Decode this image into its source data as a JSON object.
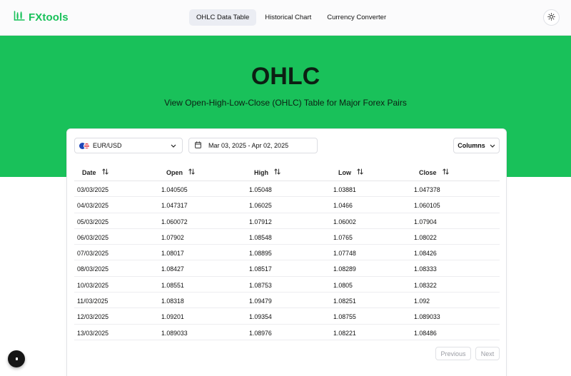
{
  "brand": {
    "name": "FXtools",
    "icon": "chart-logo-icon",
    "color": "#19c15a"
  },
  "nav": {
    "items": [
      {
        "label": "OHLC Data Table",
        "active": true
      },
      {
        "label": "Historical Chart",
        "active": false
      },
      {
        "label": "Currency Converter",
        "active": false
      }
    ],
    "theme_icon": "sun-icon"
  },
  "hero": {
    "title": "OHLC",
    "subtitle": "View Open-High-Low-Close (OHLC) Table for Major Forex Pairs",
    "background": "#19c15a"
  },
  "controls": {
    "pair": {
      "value": "EUR/USD",
      "icon": "eu-us-flag-icon"
    },
    "date_range": {
      "value": "Mar 03, 2025 - Apr 02, 2025",
      "icon": "calendar-icon"
    },
    "columns_label": "Columns"
  },
  "table": {
    "columns": [
      {
        "label": "Date",
        "sort_icon": "sort-arrows-icon"
      },
      {
        "label": "Open",
        "sort_icon": "sort-arrows-icon"
      },
      {
        "label": "High",
        "sort_icon": "sort-arrows-icon"
      },
      {
        "label": "Low",
        "sort_icon": "sort-arrows-icon"
      },
      {
        "label": "Close",
        "sort_icon": "sort-arrows-icon"
      }
    ],
    "rows": [
      [
        "03/03/2025",
        "1.040505",
        "1.05048",
        "1.03881",
        "1.047378"
      ],
      [
        "04/03/2025",
        "1.047317",
        "1.06025",
        "1.0466",
        "1.060105"
      ],
      [
        "05/03/2025",
        "1.060072",
        "1.07912",
        "1.06002",
        "1.07904"
      ],
      [
        "06/03/2025",
        "1.07902",
        "1.08548",
        "1.0765",
        "1.08022"
      ],
      [
        "07/03/2025",
        "1.08017",
        "1.08895",
        "1.07748",
        "1.08426"
      ],
      [
        "08/03/2025",
        "1.08427",
        "1.08517",
        "1.08289",
        "1.08333"
      ],
      [
        "10/03/2025",
        "1.08551",
        "1.08753",
        "1.0805",
        "1.08322"
      ],
      [
        "11/03/2025",
        "1.08318",
        "1.09479",
        "1.08251",
        "1.092"
      ],
      [
        "12/03/2025",
        "1.09201",
        "1.09354",
        "1.08755",
        "1.089033"
      ],
      [
        "13/03/2025",
        "1.089033",
        "1.08976",
        "1.08221",
        "1.08486"
      ]
    ]
  },
  "pagination": {
    "previous": "Previous",
    "next": "Next"
  }
}
